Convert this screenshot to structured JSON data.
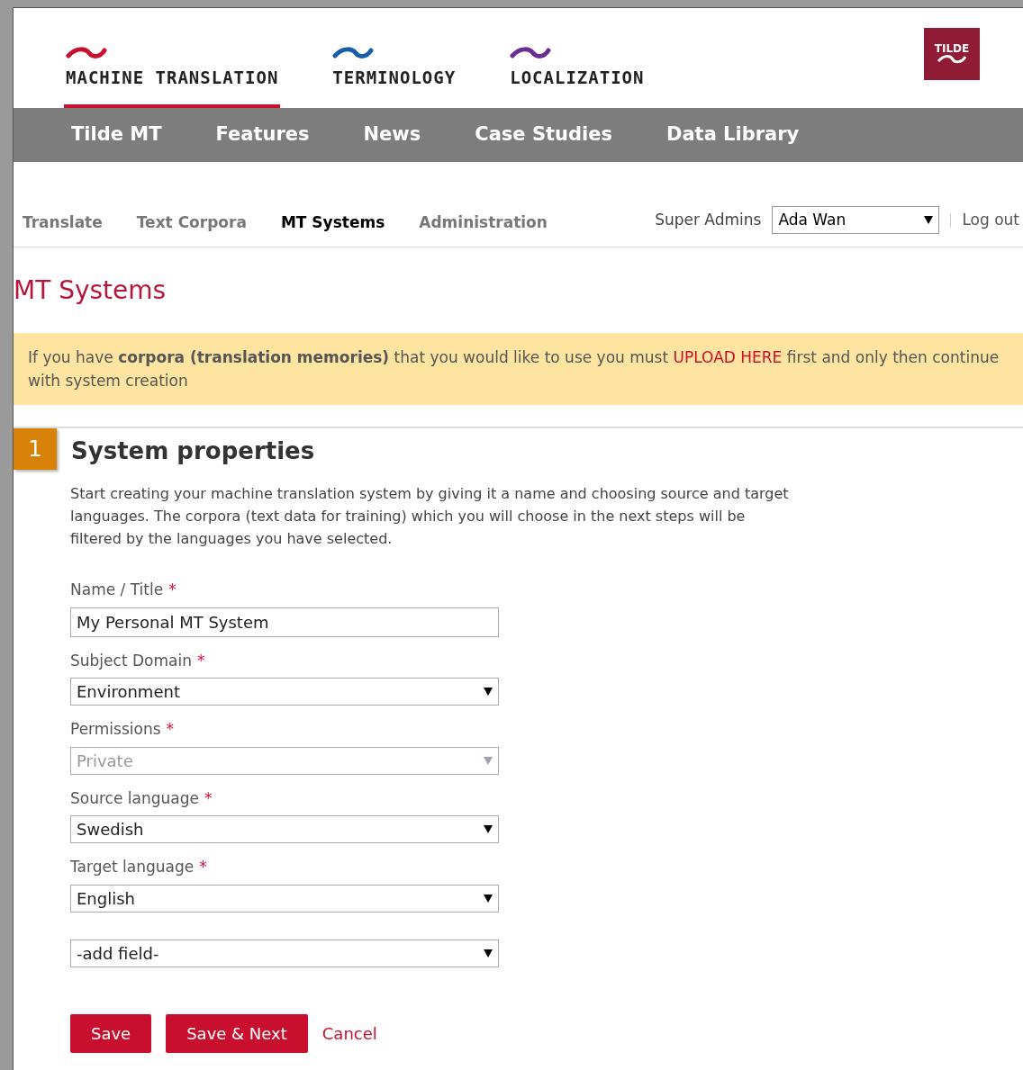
{
  "products": [
    {
      "label": "MACHINE TRANSLATION",
      "color": "#c8102e",
      "selected": true
    },
    {
      "label": "TERMINOLOGY",
      "color": "#1a5ea8",
      "selected": false
    },
    {
      "label": "LOCALIZATION",
      "color": "#6b2d91",
      "selected": false
    }
  ],
  "logo": {
    "text": "TILDE"
  },
  "main_nav": [
    {
      "label": "Tilde MT"
    },
    {
      "label": "Features"
    },
    {
      "label": "News"
    },
    {
      "label": "Case Studies"
    },
    {
      "label": "Data Library"
    }
  ],
  "sub_nav": [
    {
      "label": "Translate",
      "selected": false
    },
    {
      "label": "Text Corpora",
      "selected": false
    },
    {
      "label": "MT Systems",
      "selected": true
    },
    {
      "label": "Administration",
      "selected": false
    }
  ],
  "user_bar": {
    "group": "Super Admins",
    "user": "Ada Wan",
    "logout": "Log out"
  },
  "page_title": "MT Systems",
  "notice": {
    "text": "If you have **corpora (translation memories)** that you would like to use you must",
    "link": "UPLOAD HERE",
    "after": "first and only then continue with system creation"
  },
  "step": {
    "number": "1",
    "title": "System properties",
    "description": "Start creating your machine translation system by giving it a name and choosing source and target languages. The corpora (text data for training) which you will choose in the next steps will be filtered by the languages you have selected."
  },
  "fields": [
    {
      "kind": "text",
      "label": "Name / Title",
      "required_mark": "*",
      "value": "My Personal MT System",
      "disabled": false
    },
    {
      "kind": "select",
      "label": "Subject Domain",
      "required_mark": "*",
      "value": "Environment",
      "disabled": false
    },
    {
      "kind": "select",
      "label": "Permissions",
      "required_mark": "*",
      "value": "Private",
      "disabled": true
    },
    {
      "kind": "select",
      "label": "Source language",
      "required_mark": "*",
      "value": "Swedish",
      "disabled": false
    },
    {
      "kind": "select",
      "label": "Target language",
      "required_mark": "*",
      "value": "English",
      "disabled": false
    },
    {
      "kind": "select",
      "value": "-add field-",
      "disabled": false
    }
  ],
  "actions": [
    {
      "kind": "button",
      "label": "Save"
    },
    {
      "kind": "button",
      "label": "Save & Next"
    },
    {
      "kind": "link",
      "label": "Cancel"
    }
  ]
}
